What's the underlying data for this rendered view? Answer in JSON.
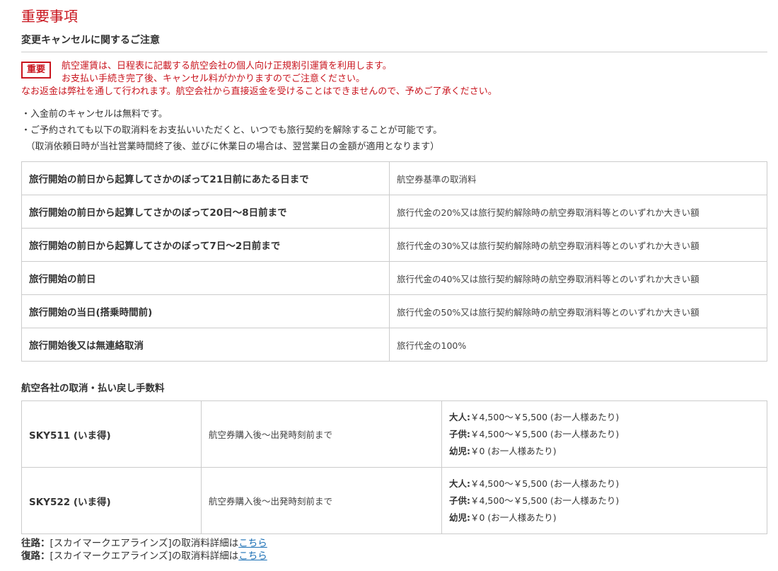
{
  "page_title": "重要事項",
  "section_title": "変更キャンセルに関するご注意",
  "important": {
    "badge": "重要",
    "line1": "航空運賃は、日程表に記載する航空会社の個人向け正規割引運賃を利用します。",
    "line2": "お支払い手続き完了後、キャンセル料がかかりますのでご注意ください。",
    "line3": "なお返金は弊社を通して行われます。航空会社から直接返金を受けることはできませんので、予めご了承ください。"
  },
  "bullets": [
    "・入金前のキャンセルは無料です。",
    "・ご予約されても以下の取消料をお支払いいただくと、いつでも旅行契約を解除することが可能です。",
    "　（取消依頼日時が当社営業時間終了後、並びに休業日の場合は、翌営業日の金額が適用となります）"
  ],
  "cancellation_fees": [
    {
      "period": "旅行開始の前日から起算してさかのぼって21日前にあたる日まで",
      "fee": "航空券基準の取消料"
    },
    {
      "period": "旅行開始の前日から起算してさかのぼって20日〜8日前まで",
      "fee": "旅行代金の20%又は旅行契約解除時の航空券取消料等とのいずれか大きい額"
    },
    {
      "period": "旅行開始の前日から起算してさかのぼって7日〜2日前まで",
      "fee": "旅行代金の30%又は旅行契約解除時の航空券取消料等とのいずれか大きい額"
    },
    {
      "period": "旅行開始の前日",
      "fee": "旅行代金の40%又は旅行契約解除時の航空券取消料等とのいずれか大きい額"
    },
    {
      "period": "旅行開始の当日(搭乗時間前)",
      "fee": "旅行代金の50%又は旅行契約解除時の航空券取消料等とのいずれか大きい額"
    },
    {
      "period": "旅行開始後又は無連絡取消",
      "fee": "旅行代金の100%"
    }
  ],
  "airline_section_title": "航空各社の取消・払い戻し手数料",
  "airline_fees": [
    {
      "flight": "SKY511 (いま得)",
      "period": "航空券購入後〜出発時刻前まで",
      "prices": [
        {
          "label": "大人:",
          "value": "￥4,500〜￥5,500 (お一人様あたり)"
        },
        {
          "label": "子供:",
          "value": "￥4,500〜￥5,500 (お一人様あたり)"
        },
        {
          "label": "幼児:",
          "value": "￥0 (お一人様あたり)"
        }
      ]
    },
    {
      "flight": "SKY522 (いま得)",
      "period": "航空券購入後〜出発時刻前まで",
      "prices": [
        {
          "label": "大人:",
          "value": "￥4,500〜￥5,500 (お一人様あたり)"
        },
        {
          "label": "子供:",
          "value": "￥4,500〜￥5,500 (お一人様あたり)"
        },
        {
          "label": "幼児:",
          "value": "￥0 (お一人様あたり)"
        }
      ]
    }
  ],
  "links": [
    {
      "label": "往路：",
      "text": "[スカイマークエアラインズ]の取消料詳細は",
      "link_text": "こちら"
    },
    {
      "label": "復路：",
      "text": "[スカイマークエアラインズ]の取消料詳細は",
      "link_text": "こちら"
    }
  ]
}
